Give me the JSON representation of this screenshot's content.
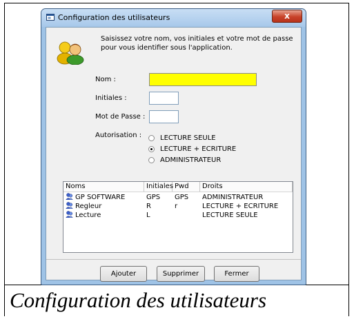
{
  "caption": "Configuration des utilisateurs",
  "window": {
    "title": "Configuration des utilisateurs",
    "close_glyph": "x"
  },
  "intro": {
    "line1": "Saisissez votre nom, vos initiales et votre mot de passe",
    "line2": "pour vous identifier sous l'application."
  },
  "form": {
    "nom_label": "Nom :",
    "nom_value": "",
    "initiales_label": "Initiales :",
    "initiales_value": "",
    "motdepasse_label": "Mot de Passe :",
    "motdepasse_value": "",
    "autorisation_label": "Autorisation :"
  },
  "autorisation": {
    "options": [
      "LECTURE SEULE",
      "LECTURE + ECRITURE",
      "ADMINISTRATEUR"
    ],
    "selected": "LECTURE + ECRITURE"
  },
  "table": {
    "columns": [
      "Noms",
      "Initiales",
      "Pwd",
      "Droits"
    ],
    "rows": [
      {
        "nom": "GP SOFTWARE",
        "initiales": "GPS",
        "pwd": "GPS",
        "droits": "ADMINISTRATEUR"
      },
      {
        "nom": "Regleur",
        "initiales": "R",
        "pwd": "r",
        "droits": "LECTURE + ECRITURE"
      },
      {
        "nom": "Lecture",
        "initiales": "L",
        "pwd": "",
        "droits": "LECTURE SEULE"
      }
    ]
  },
  "buttons": {
    "ajouter": "Ajouter",
    "supprimer": "Supprimer",
    "fermer": "Fermer"
  },
  "colors": {
    "nom_field_background": "#ffff00",
    "close_button": "#c8432a",
    "window_frame": "#9fc3e6"
  },
  "icons": {
    "title": "window-app-icon",
    "header": "users-icon",
    "row": "user-row-icon"
  }
}
